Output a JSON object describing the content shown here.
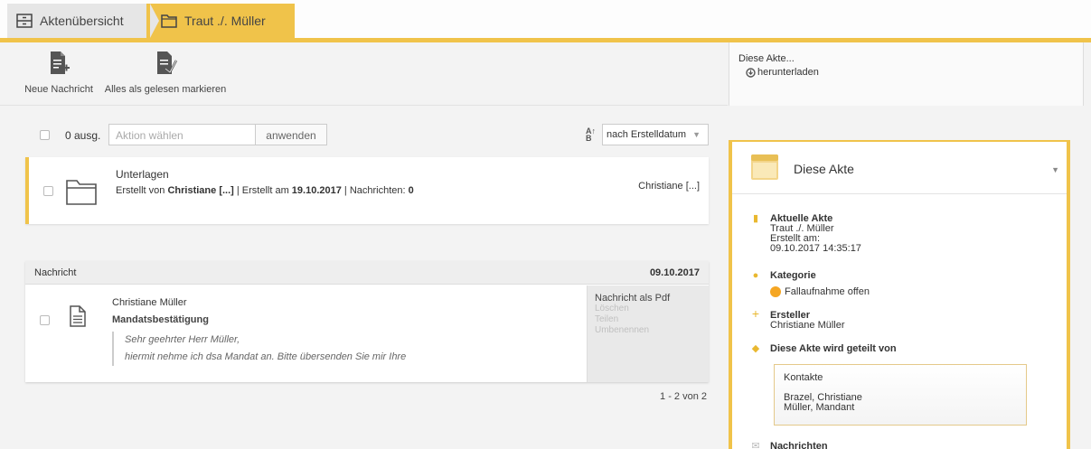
{
  "tabs": {
    "overview": "Aktenübersicht",
    "case": "Traut ./. Müller"
  },
  "toolbar": {
    "new_message": "Neue Nachricht",
    "mark_all_read": "Alles als gelesen markieren"
  },
  "file_menu": {
    "title": "Diese Akte...",
    "download": "herunterladen"
  },
  "filter": {
    "selected_count": "0 ausg.",
    "action_placeholder": "Aktion wählen",
    "apply": "anwenden",
    "sort_icon": "A↑B",
    "sort_value": "nach Erstelldatum"
  },
  "folder": {
    "title": "Unterlagen",
    "meta_prefix": "Erstellt von ",
    "creator": "Christiane [...]",
    "meta_mid": " | Erstellt am ",
    "date": "19.10.2017",
    "meta_suffix": " | Nachrichten: ",
    "count": "0",
    "right": "Christiane [...]"
  },
  "message": {
    "header_left": "Nachricht",
    "header_date": "09.10.2017",
    "from": "Christiane Müller",
    "subject": "Mandatsbestätigung",
    "quote_line1": "Sehr geehrter Herr Müller,",
    "quote_line2": "hiermit nehme ich dsa Mandat an. Bitte übersenden Sie mir Ihre",
    "actions": [
      "Nachricht als Pdf",
      "Löschen",
      "Teilen",
      "Umbenennen"
    ]
  },
  "pager": "1 - 2 von 2",
  "panel": {
    "title": "Diese Akte",
    "current_label": "Aktuelle Akte",
    "current_name": "Traut ./. Müller",
    "created_label": "Erstellt am:",
    "created_value": "09.10.2017 14:35:17",
    "category_label": "Kategorie",
    "category_value": "Fallaufnahme offen",
    "creator_label": "Ersteller",
    "creator_value": "Christiane Müller",
    "shared_label": "Diese Akte wird geteilt von",
    "contacts_label": "Kontakte",
    "contact1": "Brazel, Christiane",
    "contact2": "Müller, Mandant",
    "messages_label": "Nachrichten"
  },
  "colors": {
    "accent": "#f0c34a",
    "category_dot": "#f5a623"
  }
}
